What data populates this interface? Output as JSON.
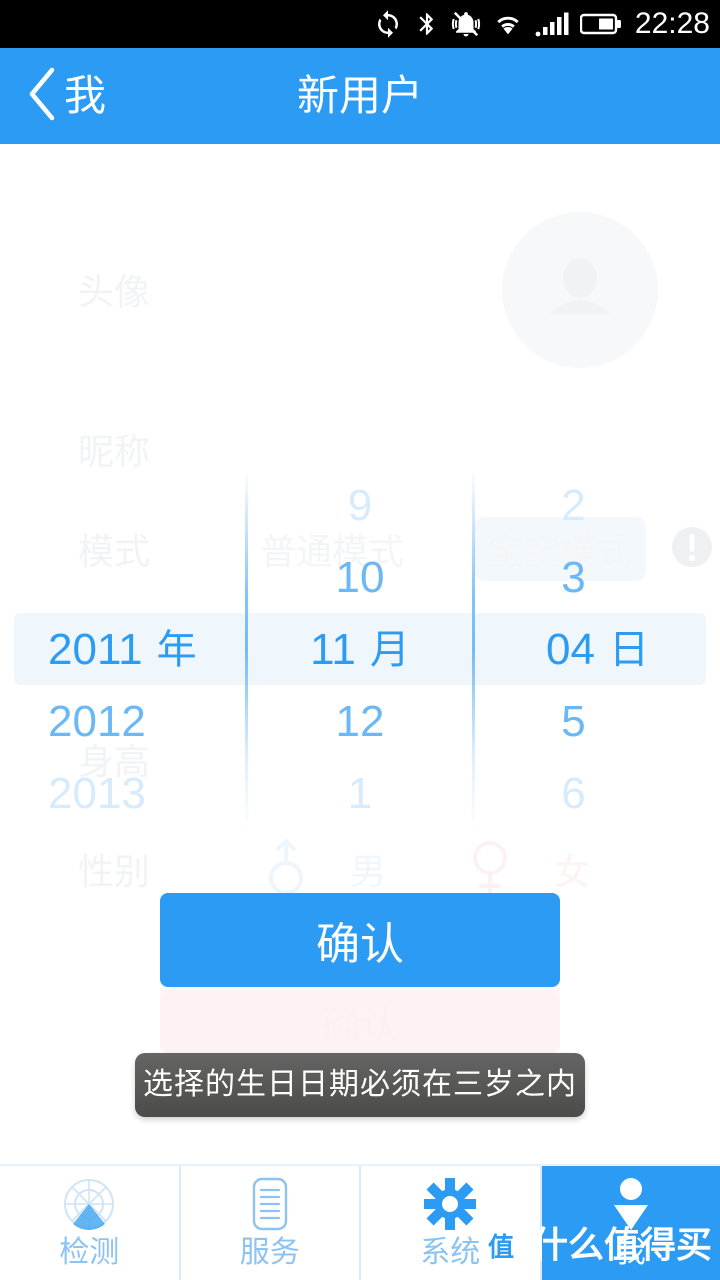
{
  "statusbar": {
    "time": "22:28",
    "icons": [
      "sync-icon",
      "bluetooth-icon",
      "mute-vibrate-icon",
      "wifi-icon",
      "cellular-signal-icon",
      "battery-icon"
    ]
  },
  "header": {
    "back_label": "我",
    "title": "新用户",
    "background_color": "#2b9bf4"
  },
  "form_background": {
    "avatar_label": "头像",
    "nickname_label": "昵称",
    "mode_label": "模式",
    "mode_options": [
      "普通模式",
      "宝宝模式"
    ],
    "mode_selected": "宝宝模式",
    "mode_info_icon": "info-exclamation-icon",
    "height_label": "身高",
    "gender_label": "性别",
    "gender_male": "男",
    "gender_female": "女",
    "submit_label": "确认"
  },
  "date_picker": {
    "year_column": [
      {
        "value": "",
        "unit": "",
        "level": "far"
      },
      {
        "value": "",
        "unit": "",
        "level": "near"
      },
      {
        "value": "2011",
        "unit": "年",
        "level": "sel"
      },
      {
        "value": "2012",
        "unit": "",
        "level": "near"
      },
      {
        "value": "2013",
        "unit": "",
        "level": "far"
      }
    ],
    "month_column": [
      {
        "value": "9",
        "unit": "",
        "level": "far"
      },
      {
        "value": "10",
        "unit": "",
        "level": "near"
      },
      {
        "value": "11",
        "unit": "月",
        "level": "sel"
      },
      {
        "value": "12",
        "unit": "",
        "level": "near"
      },
      {
        "value": "1",
        "unit": "",
        "level": "far"
      }
    ],
    "day_column": [
      {
        "value": "2",
        "unit": "",
        "level": "far"
      },
      {
        "value": "3",
        "unit": "",
        "level": "near"
      },
      {
        "value": "04",
        "unit": "日",
        "level": "sel"
      },
      {
        "value": "5",
        "unit": "",
        "level": "near"
      },
      {
        "value": "6",
        "unit": "far"
      }
    ],
    "selected_year": "2011",
    "selected_month": "11",
    "selected_day": "04",
    "unit_year": "年",
    "unit_month": "月",
    "unit_day": "日",
    "accent_color": "#2b9bf4",
    "selected_band_color": "#eff7fd"
  },
  "confirm_button": {
    "label": "确认",
    "background_color": "#2b9bf4",
    "text_color": "#ffffff"
  },
  "toast": {
    "message": "选择的生日日期必须在三岁之内",
    "background_color": "#585856"
  },
  "tabbar": {
    "items": [
      {
        "label": "检测",
        "icon": "radar-icon",
        "active": false
      },
      {
        "label": "服务",
        "icon": "document-list-icon",
        "active": false
      },
      {
        "label": "系统",
        "icon": "gear-icon",
        "active": false
      },
      {
        "label": "我",
        "icon": "person-icon",
        "active": true
      }
    ],
    "inactive_color": "#8cc3f2",
    "active_color": "#2b9bf4"
  },
  "watermark": {
    "badge": "值",
    "text": "什么值得买"
  }
}
